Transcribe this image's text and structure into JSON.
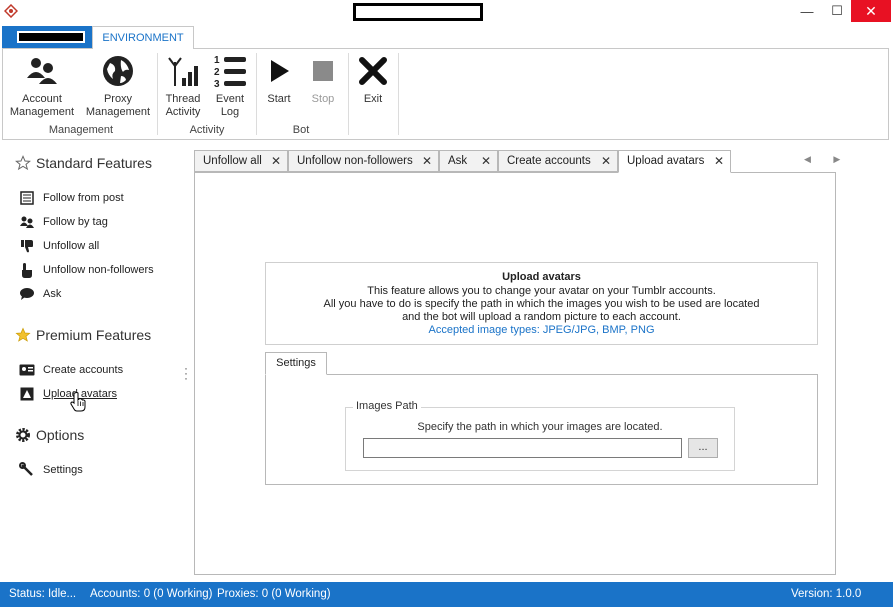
{
  "titlebar": {
    "minimize": "—",
    "maximize": "☐",
    "close": "✕"
  },
  "ribbon": {
    "tab_environment": "ENVIRONMENT",
    "groups": {
      "management": "Management",
      "activity": "Activity",
      "bot": "Bot"
    },
    "buttons": {
      "account_management_1": "Account",
      "account_management_2": "Management",
      "proxy_management_1": "Proxy",
      "proxy_management_2": "Management",
      "thread_activity_1": "Thread",
      "thread_activity_2": "Activity",
      "event_log_1": "Event",
      "event_log_2": "Log",
      "start": "Start",
      "stop": "Stop",
      "exit": "Exit"
    },
    "event_log_numbers": [
      "1",
      "2",
      "3"
    ]
  },
  "sidebar": {
    "standard_header": "Standard Features",
    "standard_items": [
      {
        "label": "Follow from post",
        "icon": "list-icon"
      },
      {
        "label": "Follow by tag",
        "icon": "users-icon"
      },
      {
        "label": "Unfollow all",
        "icon": "thumbs-down-icon"
      },
      {
        "label": "Unfollow non-followers",
        "icon": "pointing-hand-icon"
      },
      {
        "label": "Ask",
        "icon": "speech-bubble-icon"
      }
    ],
    "premium_header": "Premium Features",
    "premium_items": [
      {
        "label": "Create accounts",
        "icon": "id-card-icon"
      },
      {
        "label": "Upload avatars",
        "icon": "image-icon"
      }
    ],
    "options_header": "Options",
    "options_items": [
      {
        "label": "Settings",
        "icon": "wrench-icon"
      }
    ]
  },
  "tabs": [
    {
      "label": "Unfollow all",
      "active": false
    },
    {
      "label": "Unfollow non-followers",
      "active": false
    },
    {
      "label": "Ask",
      "active": false
    },
    {
      "label": "Create accounts",
      "active": false
    },
    {
      "label": "Upload avatars",
      "active": true
    }
  ],
  "tab_close": "✕",
  "tab_nav": "◀ ▶",
  "content": {
    "info_title": "Upload avatars",
    "info_line1": "This feature allows you to change your avatar on your Tumblr accounts.",
    "info_line2": "All you have to do is specify the path in which the images you wish to be used are located",
    "info_line3": "and the bot will upload a random picture to each account.",
    "info_types": "Accepted image types: JPEG/JPG, BMP, PNG",
    "settings_tab": "Settings",
    "images_path_legend": "Images Path",
    "images_path_desc": "Specify the path in which your images are located.",
    "images_path_value": "",
    "browse_label": "..."
  },
  "status": {
    "status": "Status: Idle...",
    "accounts": "Accounts: 0 (0 Working)",
    "proxies": "Proxies: 0 (0 Working)",
    "version": "Version: 1.0.0"
  },
  "colors": {
    "accent": "#1a73c8",
    "close_red": "#e81123",
    "text": "#222222"
  }
}
